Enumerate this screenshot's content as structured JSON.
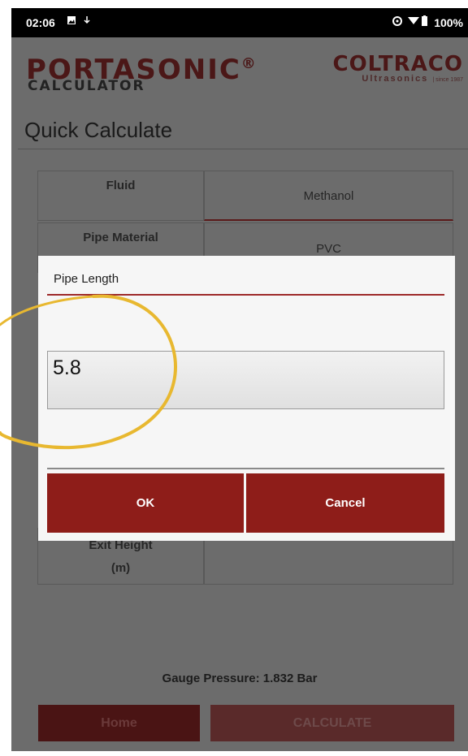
{
  "status_bar": {
    "time": "02:06",
    "icons": [
      "image-icon",
      "download-icon",
      "sync-icon",
      "wifi-icon",
      "battery-icon"
    ],
    "battery": "100%"
  },
  "header": {
    "brand": "PORTASONIC",
    "brand_mark": "®",
    "brand_sub": "CALCULATOR",
    "company": "COLTRACO",
    "company_sub": "Ultrasonics",
    "company_since": "| since 1987"
  },
  "page_title": "Quick Calculate",
  "table": {
    "rows": [
      {
        "label": "Fluid",
        "value": "Methanol"
      },
      {
        "label": "Pipe Material",
        "value": "PVC"
      },
      {
        "label_line1": "Exit Height",
        "label_line2": "(m)",
        "value": ""
      }
    ]
  },
  "gauge_pressure": "Gauge Pressure: 1.832 Bar",
  "buttons": {
    "home": "Home",
    "calculate": "CALCULATE"
  },
  "dialog": {
    "title": "Pipe Length",
    "input_value": "5.8",
    "ok": "OK",
    "cancel": "Cancel"
  },
  "colors": {
    "brand_red": "#8e1d19",
    "highlight_circle": "#e8b830"
  }
}
